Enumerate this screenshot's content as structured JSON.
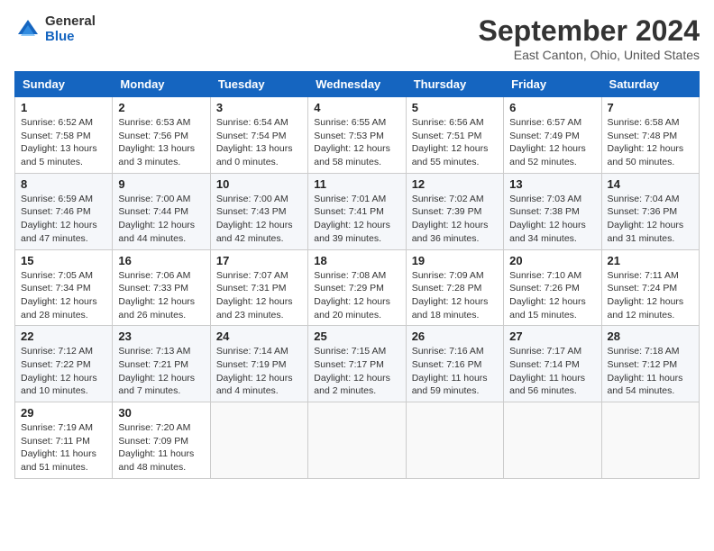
{
  "logo": {
    "general": "General",
    "blue": "Blue"
  },
  "title": "September 2024",
  "location": "East Canton, Ohio, United States",
  "headers": [
    "Sunday",
    "Monday",
    "Tuesday",
    "Wednesday",
    "Thursday",
    "Friday",
    "Saturday"
  ],
  "weeks": [
    [
      {
        "day": "1",
        "info": "Sunrise: 6:52 AM\nSunset: 7:58 PM\nDaylight: 13 hours\nand 5 minutes."
      },
      {
        "day": "2",
        "info": "Sunrise: 6:53 AM\nSunset: 7:56 PM\nDaylight: 13 hours\nand 3 minutes."
      },
      {
        "day": "3",
        "info": "Sunrise: 6:54 AM\nSunset: 7:54 PM\nDaylight: 13 hours\nand 0 minutes."
      },
      {
        "day": "4",
        "info": "Sunrise: 6:55 AM\nSunset: 7:53 PM\nDaylight: 12 hours\nand 58 minutes."
      },
      {
        "day": "5",
        "info": "Sunrise: 6:56 AM\nSunset: 7:51 PM\nDaylight: 12 hours\nand 55 minutes."
      },
      {
        "day": "6",
        "info": "Sunrise: 6:57 AM\nSunset: 7:49 PM\nDaylight: 12 hours\nand 52 minutes."
      },
      {
        "day": "7",
        "info": "Sunrise: 6:58 AM\nSunset: 7:48 PM\nDaylight: 12 hours\nand 50 minutes."
      }
    ],
    [
      {
        "day": "8",
        "info": "Sunrise: 6:59 AM\nSunset: 7:46 PM\nDaylight: 12 hours\nand 47 minutes."
      },
      {
        "day": "9",
        "info": "Sunrise: 7:00 AM\nSunset: 7:44 PM\nDaylight: 12 hours\nand 44 minutes."
      },
      {
        "day": "10",
        "info": "Sunrise: 7:00 AM\nSunset: 7:43 PM\nDaylight: 12 hours\nand 42 minutes."
      },
      {
        "day": "11",
        "info": "Sunrise: 7:01 AM\nSunset: 7:41 PM\nDaylight: 12 hours\nand 39 minutes."
      },
      {
        "day": "12",
        "info": "Sunrise: 7:02 AM\nSunset: 7:39 PM\nDaylight: 12 hours\nand 36 minutes."
      },
      {
        "day": "13",
        "info": "Sunrise: 7:03 AM\nSunset: 7:38 PM\nDaylight: 12 hours\nand 34 minutes."
      },
      {
        "day": "14",
        "info": "Sunrise: 7:04 AM\nSunset: 7:36 PM\nDaylight: 12 hours\nand 31 minutes."
      }
    ],
    [
      {
        "day": "15",
        "info": "Sunrise: 7:05 AM\nSunset: 7:34 PM\nDaylight: 12 hours\nand 28 minutes."
      },
      {
        "day": "16",
        "info": "Sunrise: 7:06 AM\nSunset: 7:33 PM\nDaylight: 12 hours\nand 26 minutes."
      },
      {
        "day": "17",
        "info": "Sunrise: 7:07 AM\nSunset: 7:31 PM\nDaylight: 12 hours\nand 23 minutes."
      },
      {
        "day": "18",
        "info": "Sunrise: 7:08 AM\nSunset: 7:29 PM\nDaylight: 12 hours\nand 20 minutes."
      },
      {
        "day": "19",
        "info": "Sunrise: 7:09 AM\nSunset: 7:28 PM\nDaylight: 12 hours\nand 18 minutes."
      },
      {
        "day": "20",
        "info": "Sunrise: 7:10 AM\nSunset: 7:26 PM\nDaylight: 12 hours\nand 15 minutes."
      },
      {
        "day": "21",
        "info": "Sunrise: 7:11 AM\nSunset: 7:24 PM\nDaylight: 12 hours\nand 12 minutes."
      }
    ],
    [
      {
        "day": "22",
        "info": "Sunrise: 7:12 AM\nSunset: 7:22 PM\nDaylight: 12 hours\nand 10 minutes."
      },
      {
        "day": "23",
        "info": "Sunrise: 7:13 AM\nSunset: 7:21 PM\nDaylight: 12 hours\nand 7 minutes."
      },
      {
        "day": "24",
        "info": "Sunrise: 7:14 AM\nSunset: 7:19 PM\nDaylight: 12 hours\nand 4 minutes."
      },
      {
        "day": "25",
        "info": "Sunrise: 7:15 AM\nSunset: 7:17 PM\nDaylight: 12 hours\nand 2 minutes."
      },
      {
        "day": "26",
        "info": "Sunrise: 7:16 AM\nSunset: 7:16 PM\nDaylight: 11 hours\nand 59 minutes."
      },
      {
        "day": "27",
        "info": "Sunrise: 7:17 AM\nSunset: 7:14 PM\nDaylight: 11 hours\nand 56 minutes."
      },
      {
        "day": "28",
        "info": "Sunrise: 7:18 AM\nSunset: 7:12 PM\nDaylight: 11 hours\nand 54 minutes."
      }
    ],
    [
      {
        "day": "29",
        "info": "Sunrise: 7:19 AM\nSunset: 7:11 PM\nDaylight: 11 hours\nand 51 minutes."
      },
      {
        "day": "30",
        "info": "Sunrise: 7:20 AM\nSunset: 7:09 PM\nDaylight: 11 hours\nand 48 minutes."
      },
      null,
      null,
      null,
      null,
      null
    ]
  ]
}
